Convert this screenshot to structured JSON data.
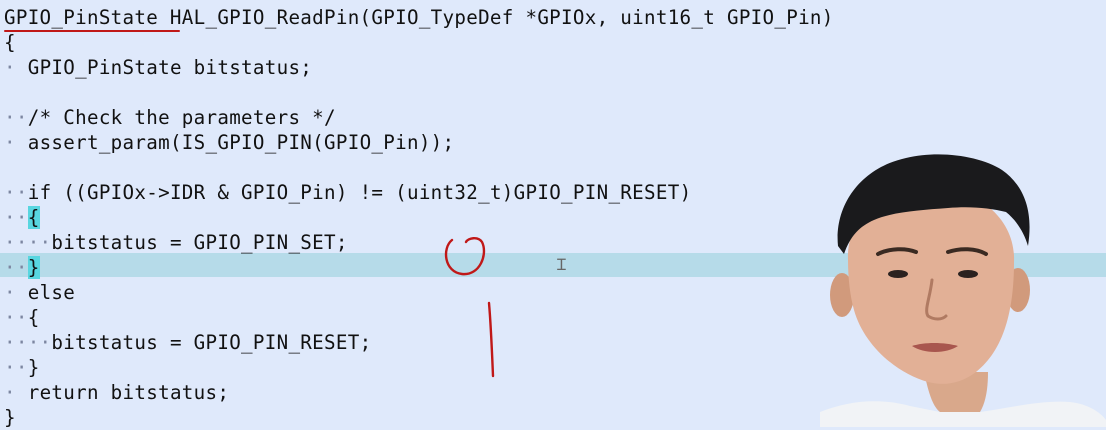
{
  "editor": {
    "lines": [
      {
        "ws": "",
        "code": "GPIO_PinState HAL_GPIO_ReadPin(GPIO_TypeDef *GPIOx, uint16_t GPIO_Pin)"
      },
      {
        "ws": "",
        "code": "{"
      },
      {
        "ws": "· ",
        "code": "GPIO_PinState bitstatus;"
      },
      {
        "ws": "",
        "code": ""
      },
      {
        "ws": "··",
        "code": "/* Check the parameters */"
      },
      {
        "ws": "· ",
        "code": "assert_param(IS_GPIO_PIN(GPIO_Pin));"
      },
      {
        "ws": "",
        "code": ""
      },
      {
        "ws": "··",
        "code": "if ((GPIOx->IDR & GPIO_Pin) != (uint32_t)GPIO_PIN_RESET)"
      },
      {
        "ws": "··",
        "code": "{"
      },
      {
        "ws": "····",
        "code": "bitstatus = GPIO_PIN_SET;"
      },
      {
        "ws": "··",
        "code": "}"
      },
      {
        "ws": "· ",
        "code": "else"
      },
      {
        "ws": "··",
        "code": "{"
      },
      {
        "ws": "····",
        "code": "bitstatus = GPIO_PIN_RESET;"
      },
      {
        "ws": "··",
        "code": "}"
      },
      {
        "ws": "· ",
        "code": "return bitstatus;"
      },
      {
        "ws": "",
        "code": "}"
      }
    ],
    "highlighted_line_index": 10,
    "colors": {
      "background": "#dfe9fb",
      "current_line": "#b6dbe9",
      "brace_match": "#58d6e0",
      "annotation_ink": "#c01818"
    }
  },
  "annotations": [
    "red-underline",
    "red-circle",
    "red-vertical-stroke"
  ],
  "overlay": {
    "presenter": "person-in-video-overlay"
  }
}
